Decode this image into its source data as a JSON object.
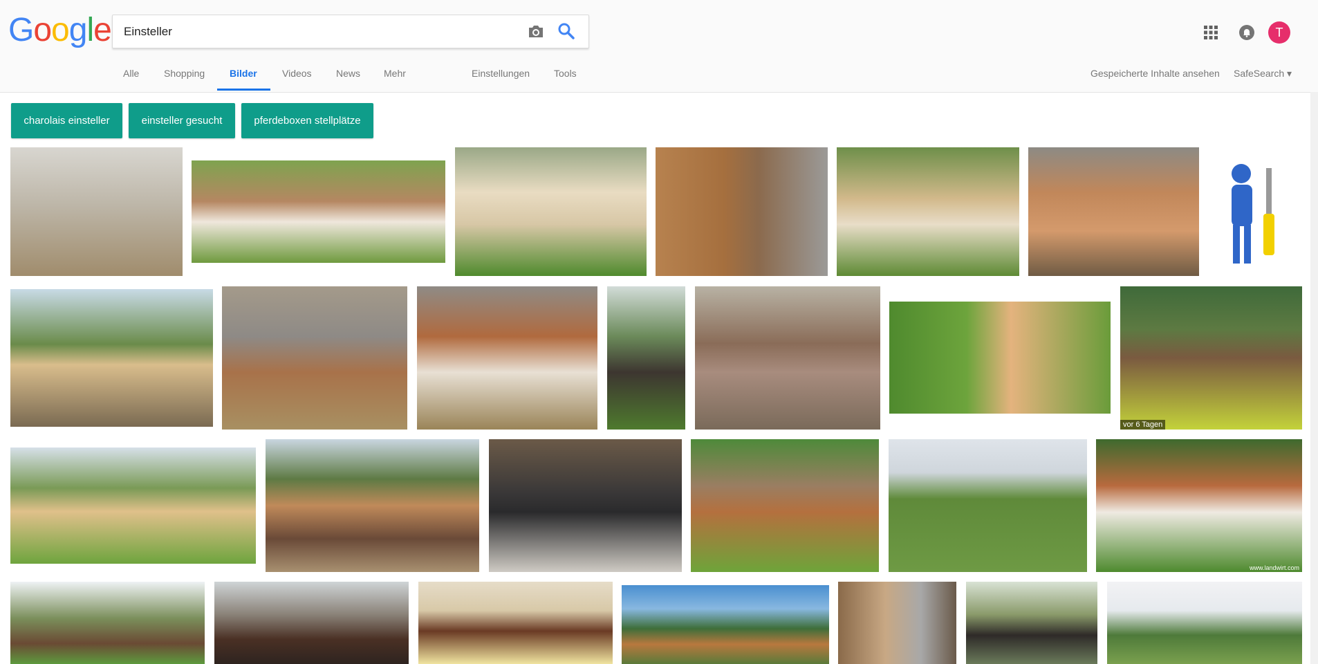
{
  "header": {
    "logo": "Google",
    "search_value": "Einsteller",
    "avatar_letter": "T"
  },
  "tabs": [
    {
      "label": "Alle"
    },
    {
      "label": "Shopping"
    },
    {
      "label": "Bilder"
    },
    {
      "label": "Videos"
    },
    {
      "label": "News"
    },
    {
      "label": "Mehr"
    },
    {
      "label": "Einstellungen"
    },
    {
      "label": "Tools"
    }
  ],
  "right_links": {
    "saved": "Gespeicherte Inhalte ansehen",
    "safesearch": "SafeSearch ▾"
  },
  "chips": [
    {
      "label": "charolais einsteller"
    },
    {
      "label": "einsteller gesucht"
    },
    {
      "label": "pferdeboxen stellplätze"
    }
  ],
  "badges": {
    "age": "vor 6 Tagen",
    "source": "www.landwirt.com"
  },
  "colors": {
    "accent": "#1a73e8",
    "chip": "#0f9d8a",
    "avatar": "#e62e6b"
  }
}
